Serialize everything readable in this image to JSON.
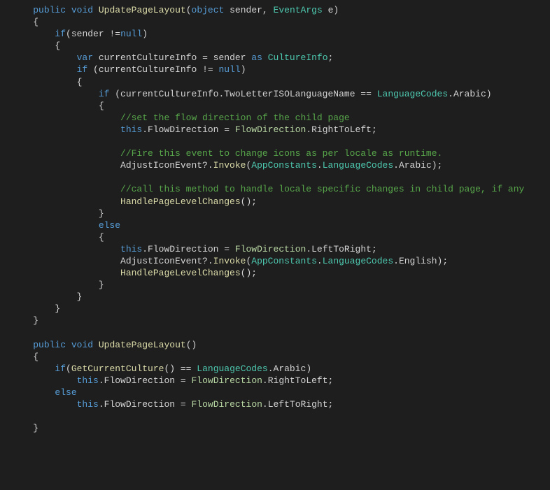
{
  "code": {
    "l1": {
      "kw1": "public",
      "kw2": "void",
      "fn": "UpdatePageLayout",
      "br1": "(",
      "type1": "object",
      "p1": " sender, ",
      "cls1": "EventArgs",
      "p2": " e",
      "br2": ")"
    },
    "l2": {
      "br": "{"
    },
    "l3": {
      "kw": "if",
      "br1": "(",
      "p1": "sender ",
      "op": "!=",
      "kw2": "null",
      "br2": ")"
    },
    "l4": {
      "br": "{"
    },
    "l5": {
      "kw": "var",
      "p1": " currentCultureInfo ",
      "op": "=",
      "p2": " sender ",
      "kw2": "as",
      "sp": " ",
      "cls": "CultureInfo",
      "sc": ";"
    },
    "l6": {
      "kw": "if",
      "p1": " (currentCultureInfo ",
      "op": "!=",
      "sp": " ",
      "kw2": "null",
      "br": ")"
    },
    "l7": {
      "br": "{"
    },
    "l8": {
      "kw": "if",
      "p1": " (currentCultureInfo.TwoLetterISOLanguageName ",
      "op": "==",
      "sp": " ",
      "cls": "LanguageCodes",
      "p2": ".Arabic)"
    },
    "l9": {
      "br": "{"
    },
    "l10": {
      "cmt": "//set the flow direction of the child page"
    },
    "l11": {
      "kw": "this",
      "p1": ".FlowDirection ",
      "op": "=",
      "sp": " ",
      "enum": "FlowDirection",
      "p2": ".RightToLeft;"
    },
    "l12": {
      "blank": ""
    },
    "l13": {
      "cmt": "//Fire this event to change icons as per locale as runtime."
    },
    "l14": {
      "p1": "AdjustIconEvent?.",
      "fn": "Invoke",
      "br1": "(",
      "cls1": "AppConstants",
      "p2": ".",
      "cls2": "LanguageCodes",
      "p3": ".Arabic);"
    },
    "l15": {
      "blank": ""
    },
    "l16": {
      "cmt": "//call this method to handle locale specific changes in child page, if any"
    },
    "l17": {
      "fn": "HandlePageLevelChanges",
      "p": "();"
    },
    "l18": {
      "br": "}"
    },
    "l19": {
      "kw": "else"
    },
    "l20": {
      "br": "{"
    },
    "l21": {
      "kw": "this",
      "p1": ".FlowDirection ",
      "op": "=",
      "sp": " ",
      "enum": "FlowDirection",
      "p2": ".LeftToRight;"
    },
    "l22": {
      "p1": "AdjustIconEvent?.",
      "fn": "Invoke",
      "br1": "(",
      "cls1": "AppConstants",
      "p2": ".",
      "cls2": "LanguageCodes",
      "p3": ".English);"
    },
    "l23": {
      "fn": "HandlePageLevelChanges",
      "p": "();"
    },
    "l24": {
      "br": "}"
    },
    "l25": {
      "br": "}"
    },
    "l26": {
      "br": "}"
    },
    "l27": {
      "br": "}"
    },
    "l28": {
      "blank": ""
    },
    "l29": {
      "kw1": "public",
      "kw2": "void",
      "fn": "UpdatePageLayout",
      "br": "()"
    },
    "l30": {
      "br": "{"
    },
    "l31": {
      "kw": "if",
      "br1": "(",
      "fn": "GetCurrentCulture",
      "p1": "() ",
      "op": "==",
      "sp": " ",
      "cls": "LanguageCodes",
      "p2": ".Arabic)"
    },
    "l32": {
      "kw": "this",
      "p1": ".FlowDirection ",
      "op": "=",
      "sp": " ",
      "enum": "FlowDirection",
      "p2": ".RightToLeft;"
    },
    "l33": {
      "kw": "else"
    },
    "l34": {
      "kw": "this",
      "p1": ".FlowDirection ",
      "op": "=",
      "sp": " ",
      "enum": "FlowDirection",
      "p2": ".LeftToRight;"
    },
    "l35": {
      "blank": ""
    },
    "l36": {
      "br": "}"
    }
  }
}
